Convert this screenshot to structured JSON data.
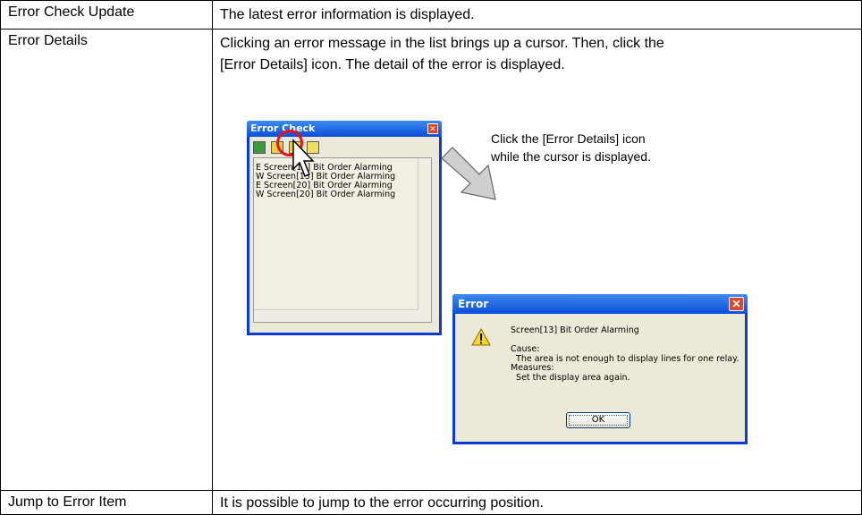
{
  "rows": [
    {
      "label": "Error Check Update",
      "desc": "The latest error information is displayed."
    },
    {
      "label": "Error Details",
      "desc_line1": "Clicking an error message in the list brings up a cursor.  Then, click the",
      "desc_line2": "[Error Details] icon.  The detail of the error is displayed."
    },
    {
      "label": "Jump to Error Item",
      "desc": "It is possible to jump to the error occurring position."
    }
  ],
  "error_check_window": {
    "title": "Error Check",
    "items": [
      "E Screen[13] Bit Order Alarming",
      "W Screen[13] Bit Order Alarming",
      "E Screen[20] Bit Order Alarming",
      "W Screen[20] Bit Order Alarming"
    ]
  },
  "instruction": "Click the [Error Details] icon\nwhile the cursor is displayed.",
  "error_dialog": {
    "title": "Error",
    "message": "Screen[13] Bit Order Alarming\n\nCause:\n  The area is not enough to display lines for one relay.\nMeasures:\n  Set the display area again.",
    "ok_label": "OK"
  }
}
